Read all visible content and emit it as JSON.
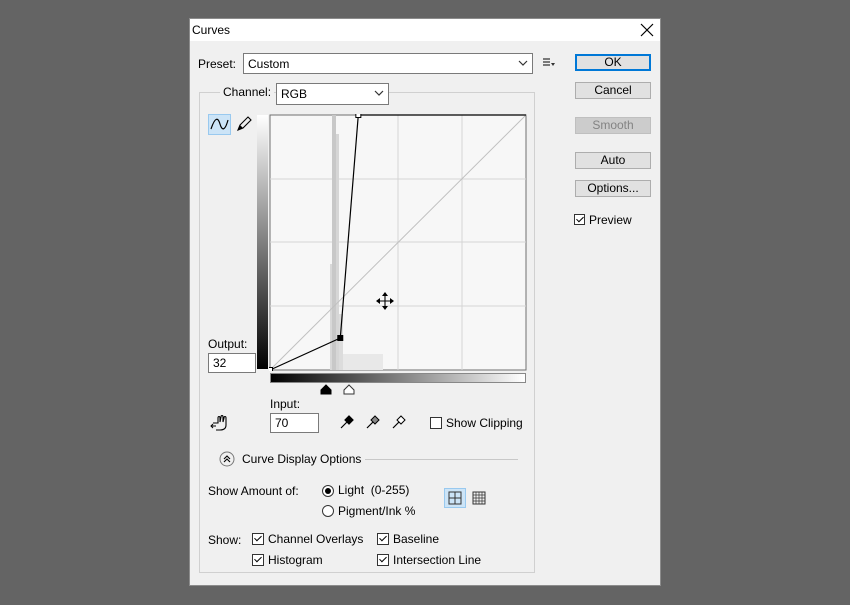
{
  "dialog": {
    "title": "Curves"
  },
  "preset": {
    "label": "Preset:",
    "value": "Custom"
  },
  "channel": {
    "label": "Channel:",
    "value": "RGB"
  },
  "buttons": {
    "ok": "OK",
    "cancel": "Cancel",
    "smooth": "Smooth",
    "auto": "Auto",
    "options": "Options..."
  },
  "preview": {
    "label": "Preview",
    "checked": true
  },
  "output": {
    "label": "Output:",
    "value": "32"
  },
  "input": {
    "label": "Input:",
    "value": "70"
  },
  "show_clipping": {
    "label": "Show Clipping",
    "checked": false
  },
  "curve_display_options": {
    "label": "Curve Display Options"
  },
  "show_amount": {
    "label": "Show Amount of:",
    "light": {
      "label": "Light",
      "range": "(0-255)",
      "selected": true
    },
    "pigment": {
      "label": "Pigment/Ink %",
      "selected": false
    }
  },
  "show": {
    "label": "Show:",
    "channel_overlays": {
      "label": "Channel Overlays",
      "checked": true
    },
    "baseline": {
      "label": "Baseline",
      "checked": true
    },
    "histogram": {
      "label": "Histogram",
      "checked": true
    },
    "intersection_line": {
      "label": "Intersection Line",
      "checked": true
    }
  },
  "curve": {
    "points": [
      [
        0,
        0
      ],
      [
        70,
        32
      ],
      [
        88,
        255
      ]
    ],
    "black_point_input": 58,
    "white_point_input": 88
  },
  "colors": {
    "accent": "#0078d7",
    "dialog_bg": "#f0f0f0",
    "backdrop": "#646464"
  }
}
